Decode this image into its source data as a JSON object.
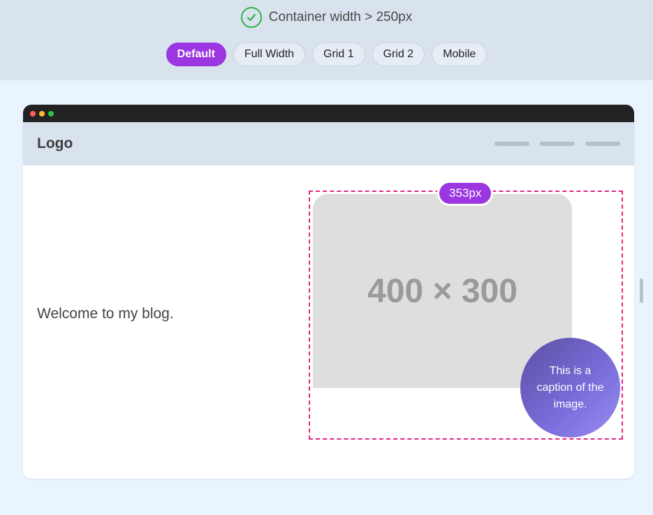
{
  "status": {
    "text": "Container width > 250px",
    "color": "#2fb14d"
  },
  "tabs": [
    {
      "label": "Default",
      "active": true
    },
    {
      "label": "Full Width",
      "active": false
    },
    {
      "label": "Grid 1",
      "active": false
    },
    {
      "label": "Grid 2",
      "active": false
    },
    {
      "label": "Mobile",
      "active": false
    }
  ],
  "window": {
    "dots": [
      "#ff5f57",
      "#febc2e",
      "#28c840"
    ]
  },
  "site": {
    "logo": "Logo",
    "welcome": "Welcome to my blog."
  },
  "figure": {
    "width_label": "353px",
    "placeholder": "400 × 300",
    "caption": "This is a caption of the image."
  },
  "colors": {
    "accent": "#9b36e0",
    "outline": "#e6247f"
  }
}
